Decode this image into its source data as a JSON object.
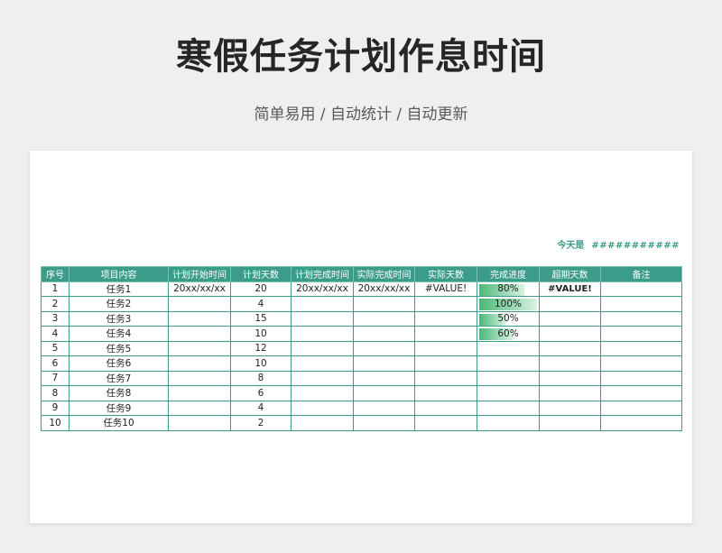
{
  "title": "寒假任务计划作息时间",
  "subtitle": "简单易用 / 自动统计 / 自动更新",
  "today": {
    "label": "今天是",
    "value": "###########"
  },
  "table": {
    "headers": [
      "序号",
      "项目内容",
      "计划开始时间",
      "计划天数",
      "计划完成时间",
      "实际完成时间",
      "实际天数",
      "完成进度",
      "超期天数",
      "备注"
    ],
    "rows": [
      {
        "no": "1",
        "item": "任务1",
        "plan_start": "20xx/xx/xx",
        "plan_days": "20",
        "plan_end": "20xx/xx/xx",
        "actual_end": "20xx/xx/xx",
        "actual_days": "#VALUE!",
        "progress": "80%",
        "progress_value": 0.8,
        "overdue": "#VALUE!",
        "note": ""
      },
      {
        "no": "2",
        "item": "任务2",
        "plan_start": "",
        "plan_days": "4",
        "plan_end": "",
        "actual_end": "",
        "actual_days": "",
        "progress": "100%",
        "progress_value": 1.0,
        "overdue": "",
        "note": ""
      },
      {
        "no": "3",
        "item": "任务3",
        "plan_start": "",
        "plan_days": "15",
        "plan_end": "",
        "actual_end": "",
        "actual_days": "",
        "progress": "50%",
        "progress_value": 0.5,
        "overdue": "",
        "note": ""
      },
      {
        "no": "4",
        "item": "任务4",
        "plan_start": "",
        "plan_days": "10",
        "plan_end": "",
        "actual_end": "",
        "actual_days": "",
        "progress": "60%",
        "progress_value": 0.6,
        "overdue": "",
        "note": ""
      },
      {
        "no": "5",
        "item": "任务5",
        "plan_start": "",
        "plan_days": "12",
        "plan_end": "",
        "actual_end": "",
        "actual_days": "",
        "progress": "",
        "progress_value": null,
        "overdue": "",
        "note": ""
      },
      {
        "no": "6",
        "item": "任务6",
        "plan_start": "",
        "plan_days": "10",
        "plan_end": "",
        "actual_end": "",
        "actual_days": "",
        "progress": "",
        "progress_value": null,
        "overdue": "",
        "note": ""
      },
      {
        "no": "7",
        "item": "任务7",
        "plan_start": "",
        "plan_days": "8",
        "plan_end": "",
        "actual_end": "",
        "actual_days": "",
        "progress": "",
        "progress_value": null,
        "overdue": "",
        "note": ""
      },
      {
        "no": "8",
        "item": "任务8",
        "plan_start": "",
        "plan_days": "6",
        "plan_end": "",
        "actual_end": "",
        "actual_days": "",
        "progress": "",
        "progress_value": null,
        "overdue": "",
        "note": ""
      },
      {
        "no": "9",
        "item": "任务9",
        "plan_start": "",
        "plan_days": "4",
        "plan_end": "",
        "actual_end": "",
        "actual_days": "",
        "progress": "",
        "progress_value": null,
        "overdue": "",
        "note": ""
      },
      {
        "no": "10",
        "item": "任务10",
        "plan_start": "",
        "plan_days": "2",
        "plan_end": "",
        "actual_end": "",
        "actual_days": "",
        "progress": "",
        "progress_value": null,
        "overdue": "",
        "note": ""
      }
    ]
  },
  "colors": {
    "accent": "#3a9c89",
    "error": "#c00000",
    "progress_bar": "#4cb878"
  }
}
